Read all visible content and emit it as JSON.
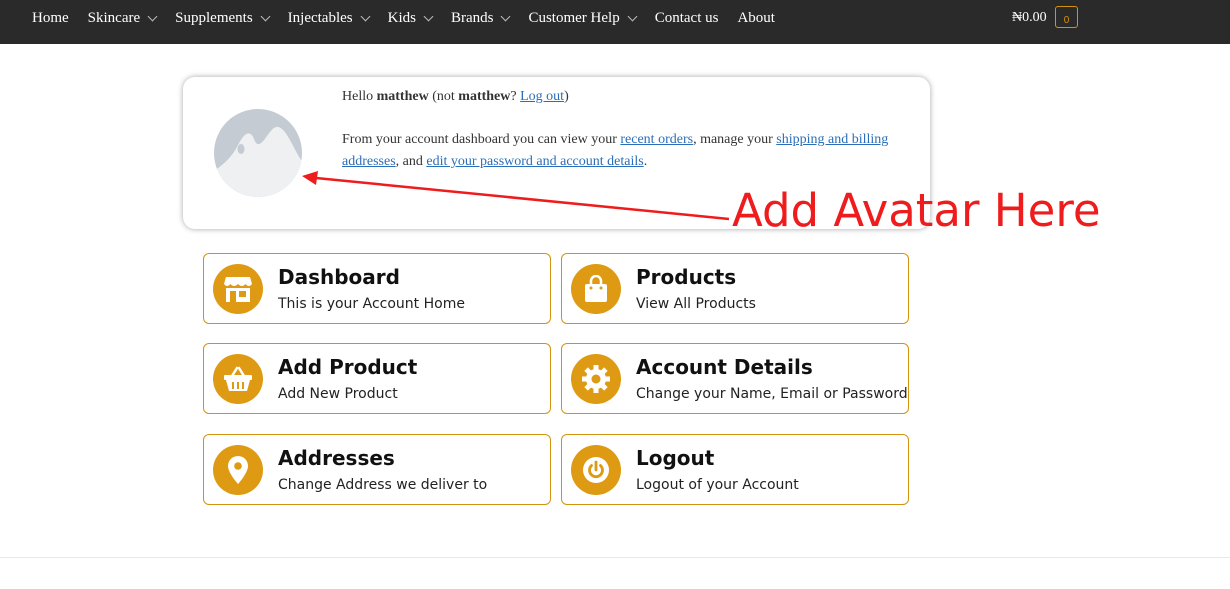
{
  "nav": {
    "items": [
      {
        "label": "Home",
        "dropdown": false
      },
      {
        "label": "Skincare",
        "dropdown": true
      },
      {
        "label": "Supplements",
        "dropdown": true
      },
      {
        "label": "Injectables",
        "dropdown": true
      },
      {
        "label": "Kids",
        "dropdown": true
      },
      {
        "label": "Brands",
        "dropdown": true
      },
      {
        "label": "Customer Help",
        "dropdown": true
      },
      {
        "label": "Contact us",
        "dropdown": false
      },
      {
        "label": "About",
        "dropdown": false
      }
    ],
    "cart_total": "₦0.00",
    "cart_count": "0"
  },
  "welcome": {
    "hello_prefix": "Hello ",
    "username": "matthew",
    "not_prefix": " (not ",
    "not_username": "matthew",
    "qmark": "? ",
    "logout_link": "Log out",
    "close_paren": ")",
    "intro_prefix": "From your account dashboard you can view your ",
    "recent_orders_link": "recent orders",
    "intro_mid": ", manage your ",
    "shipping_link": "shipping and billing addresses",
    "intro_and": ", and ",
    "edit_link": "edit your password and account details",
    "intro_end": "."
  },
  "annotation": {
    "text": "Add Avatar Here",
    "color": "#ee1c1c"
  },
  "tiles": [
    {
      "title": "Dashboard",
      "subtitle": "This is your Account Home",
      "icon": "store-icon"
    },
    {
      "title": "Products",
      "subtitle": "View All Products",
      "icon": "shopping-bag-icon"
    },
    {
      "title": "Add Product",
      "subtitle": "Add New Product",
      "icon": "basket-icon"
    },
    {
      "title": "Account Details",
      "subtitle": "Change your Name, Email or Password",
      "icon": "gear-icon"
    },
    {
      "title": "Addresses",
      "subtitle": "Change Address we deliver to",
      "icon": "map-pin-icon"
    },
    {
      "title": "Logout",
      "subtitle": "Logout of your Account",
      "icon": "power-icon"
    }
  ],
  "colors": {
    "accent": "#df9a13",
    "topbar": "#2a2a2a",
    "link": "#2a6eb9"
  }
}
